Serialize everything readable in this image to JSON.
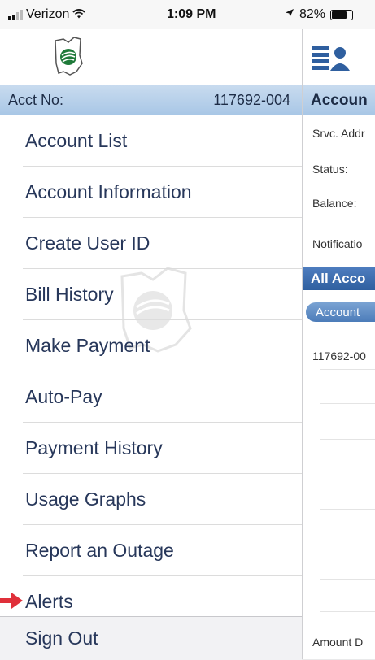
{
  "status_bar": {
    "carrier": "Verizon",
    "time": "1:09 PM",
    "battery": "82%",
    "battery_level": 0.82,
    "icons": [
      "signal-icon",
      "wifi-icon",
      "location-icon",
      "battery-icon"
    ]
  },
  "drawer": {
    "account_label": "Acct No:",
    "account_number": "117692-004",
    "menu_items": [
      {
        "label": "Account List"
      },
      {
        "label": "Account Information"
      },
      {
        "label": "Create User ID"
      },
      {
        "label": "Bill History"
      },
      {
        "label": "Make Payment"
      },
      {
        "label": "Auto-Pay"
      },
      {
        "label": "Payment History"
      },
      {
        "label": "Usage Graphs"
      },
      {
        "label": "Report an Outage"
      },
      {
        "label": "Alerts"
      }
    ],
    "sign_out": "Sign Out"
  },
  "content": {
    "header": "Accoun",
    "fields": {
      "service_address": "Srvc. Addr",
      "status": "Status:",
      "balance": "Balance:",
      "notifications": "Notificatio"
    },
    "section_title": "All Acco",
    "column_pill": "Account",
    "first_account": "117692-00",
    "footer": "Amount D"
  },
  "colors": {
    "accent_blue": "#2f5f9f",
    "header_blue": "#a9c7e6",
    "menu_text": "#27375a",
    "arrow_red": "#e0303a",
    "logo_green": "#1f7a3a"
  }
}
